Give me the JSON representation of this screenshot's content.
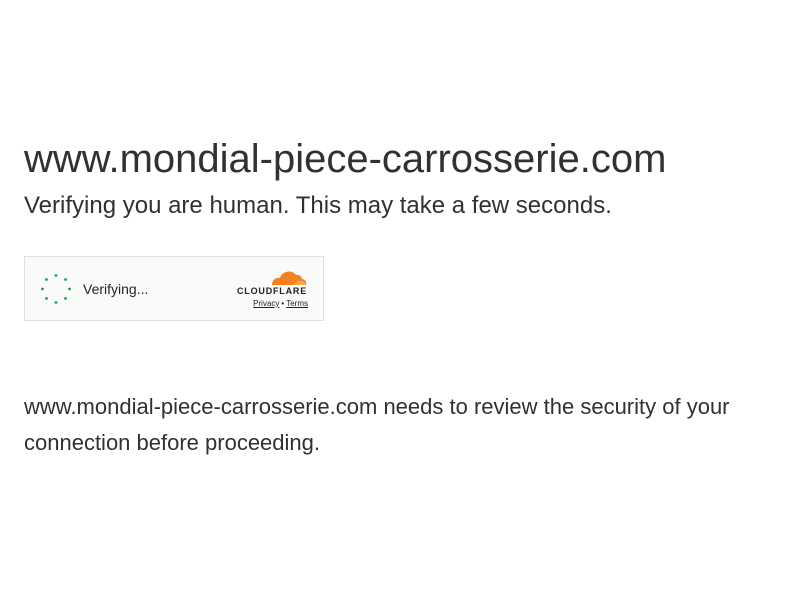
{
  "page": {
    "site_title": "www.mondial-piece-carrosserie.com",
    "subtitle": "Verifying you are human. This may take a few seconds.",
    "notice": "www.mondial-piece-carrosserie.com needs to review the security of your connection before proceeding."
  },
  "widget": {
    "status_label": "Verifying...",
    "spinner_icon": "loading-spinner-icon",
    "brand_logo": "cloudflare-logo",
    "brand_text": "CLOUDFLARE",
    "privacy_link": "Privacy",
    "separator": "•",
    "terms_link": "Terms"
  },
  "colors": {
    "text": "#313131",
    "spinner": "#19a54a",
    "cloud_orange": "#f48120",
    "cloud_light": "#faad3f",
    "widget_border": "#e0e0e0",
    "widget_bg": "#fafafa"
  }
}
